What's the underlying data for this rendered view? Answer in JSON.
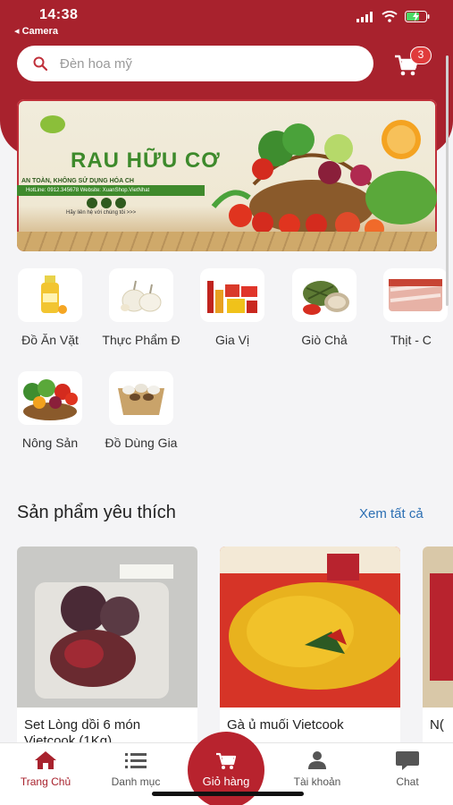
{
  "status": {
    "time": "14:38",
    "back_label": "◂ Camera"
  },
  "search": {
    "placeholder": "Đèn hoa mỹ"
  },
  "cart": {
    "count": "3"
  },
  "banner": {
    "title": "RAU HỮU CƠ",
    "subtitle": "AN TOÀN, KHÔNG SỬ DỤNG HÓA CH",
    "hotline": "HotLine: 0912.345678    Website: XuanShop.VietNhat",
    "contact": "Hãy liên hệ với chúng tôi >>>"
  },
  "categories": [
    {
      "label": "Đồ Ăn Vặt"
    },
    {
      "label": "Thực Phẩm Đ"
    },
    {
      "label": "Gia Vị"
    },
    {
      "label": "Giò Chả"
    },
    {
      "label": "Thịt - C"
    },
    {
      "label": "Nông Sản"
    },
    {
      "label": "Đồ Dùng Gia"
    }
  ],
  "favorites": {
    "title": "Sản phẩm yêu thích",
    "see_all": "Xem tất cả",
    "products": [
      {
        "name": "Set Lòng dồi 6 món Vietcook (1Kg)"
      },
      {
        "name": "Gà ủ muối Vietcook"
      },
      {
        "name": "N("
      }
    ]
  },
  "tabs": {
    "home": "Trang Chủ",
    "menu": "Danh mục",
    "cart": "Giỏ hàng",
    "account": "Tài khoản",
    "chat": "Chat"
  },
  "colors": {
    "brand": "#a8222d",
    "link": "#2c6fb3"
  }
}
